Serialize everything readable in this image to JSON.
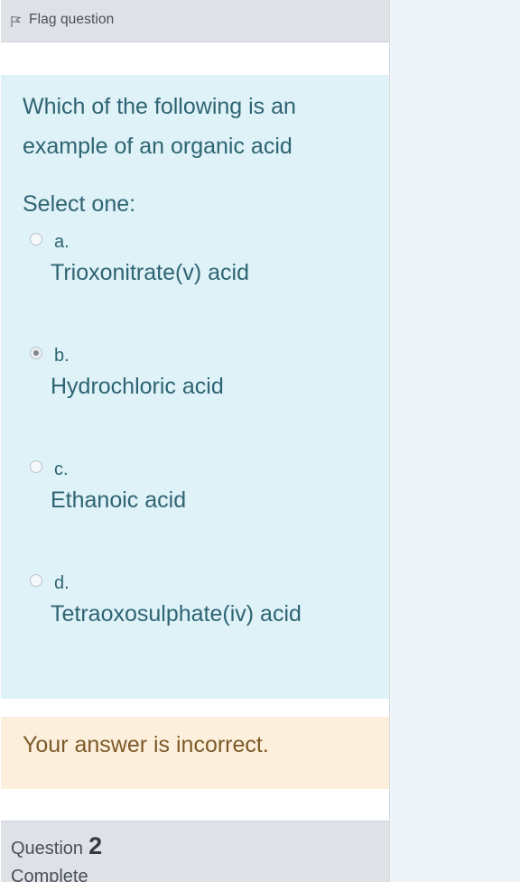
{
  "flag": {
    "label": "Flag question",
    "icon": "flag-icon"
  },
  "question": {
    "text": "Which of the following is an example of an organic acid",
    "prompt": "Select one:",
    "options": [
      {
        "letter": "a.",
        "text": "Trioxonitrate(v) acid",
        "selected": false
      },
      {
        "letter": "b.",
        "text": "Hydrochloric acid",
        "selected": true
      },
      {
        "letter": "c.",
        "text": "Ethanoic acid",
        "selected": false
      },
      {
        "letter": "d.",
        "text": "Tetraoxosulphate(iv) acid",
        "selected": false
      }
    ]
  },
  "feedback": {
    "text": "Your answer is incorrect."
  },
  "next_question": {
    "label": "Question",
    "number": "2",
    "status": "Complete"
  },
  "colors": {
    "question_bg": "#def2f8",
    "question_text": "#2f6473",
    "feedback_bg": "#fcefdc",
    "feedback_text": "#7d5a29",
    "header_bg": "#dee2e6"
  }
}
